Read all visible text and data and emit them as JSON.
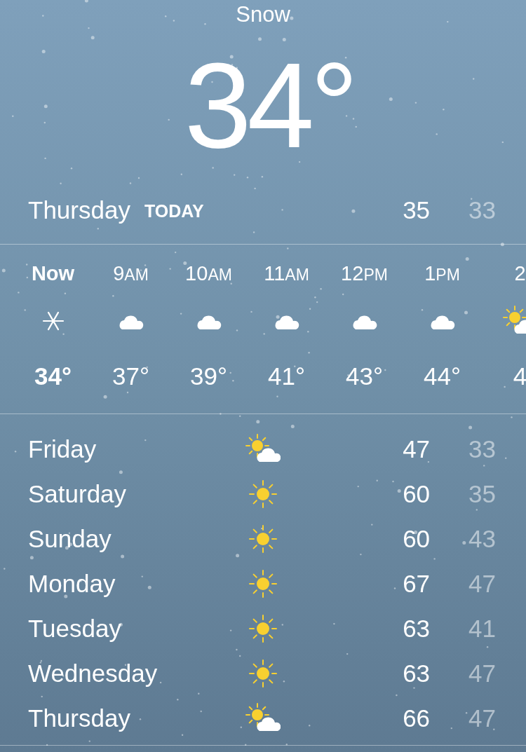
{
  "condition": "Snow",
  "temperature": "34°",
  "today": {
    "day": "Thursday",
    "label": "TODAY",
    "high": "35",
    "low": "33"
  },
  "hourly": [
    {
      "time": "Now",
      "kind": "snow",
      "temp": "34°",
      "selected": true
    },
    {
      "time": "9",
      "period": "AM",
      "kind": "cloudy",
      "temp": "37°",
      "selected": false
    },
    {
      "time": "10",
      "period": "AM",
      "kind": "cloudy",
      "temp": "39°",
      "selected": false
    },
    {
      "time": "11",
      "period": "AM",
      "kind": "cloudy",
      "temp": "41°",
      "selected": false
    },
    {
      "time": "12",
      "period": "PM",
      "kind": "cloudy",
      "temp": "43°",
      "selected": false
    },
    {
      "time": "1",
      "period": "PM",
      "kind": "cloudy",
      "temp": "44°",
      "selected": false
    },
    {
      "time": "2",
      "kind": "partly_sunny",
      "temp": "4",
      "selected": false
    }
  ],
  "daily": [
    {
      "day": "Friday",
      "kind": "partly_sunny",
      "high": "47",
      "low": "33"
    },
    {
      "day": "Saturday",
      "kind": "sunny",
      "high": "60",
      "low": "35"
    },
    {
      "day": "Sunday",
      "kind": "sunny",
      "high": "60",
      "low": "43"
    },
    {
      "day": "Monday",
      "kind": "sunny",
      "high": "67",
      "low": "47"
    },
    {
      "day": "Tuesday",
      "kind": "sunny",
      "high": "63",
      "low": "41"
    },
    {
      "day": "Wednesday",
      "kind": "sunny",
      "high": "63",
      "low": "47"
    },
    {
      "day": "Thursday",
      "kind": "partly_sunny",
      "high": "66",
      "low": "47"
    }
  ]
}
